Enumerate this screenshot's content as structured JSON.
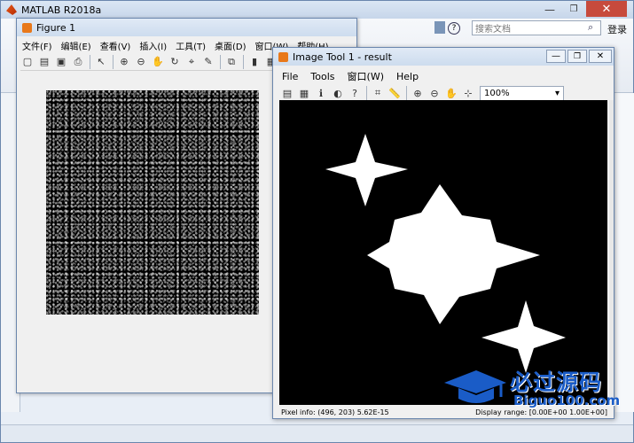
{
  "matlab": {
    "title": "MATLAB R2018a",
    "search_placeholder": "搜索文档",
    "login_label": "登录",
    "minimize_glyph": "—",
    "maximize_glyph": "❐",
    "close_glyph": "✕"
  },
  "figure": {
    "title": "Figure 1",
    "menu": [
      "文件(F)",
      "编辑(E)",
      "查看(V)",
      "插入(I)",
      "工具(T)",
      "桌面(D)",
      "窗口(W)",
      "帮助(H)"
    ]
  },
  "imtool": {
    "title": "Image Tool 1 - result",
    "menu": [
      "File",
      "Tools",
      "窗口(W)",
      "Help"
    ],
    "zoom_value": "100%",
    "pixel_info": "Pixel info: (496, 203)  5.62E-15",
    "display_range": "Display range: [0.00E+00 1.00E+00]"
  },
  "watermark": {
    "text": "必过源码",
    "subtext": "Biguo100.com"
  },
  "colors": {
    "titlebar": "#cddcee",
    "close_button": "#c74a3c",
    "watermark_blue": "#1a5cc7"
  }
}
